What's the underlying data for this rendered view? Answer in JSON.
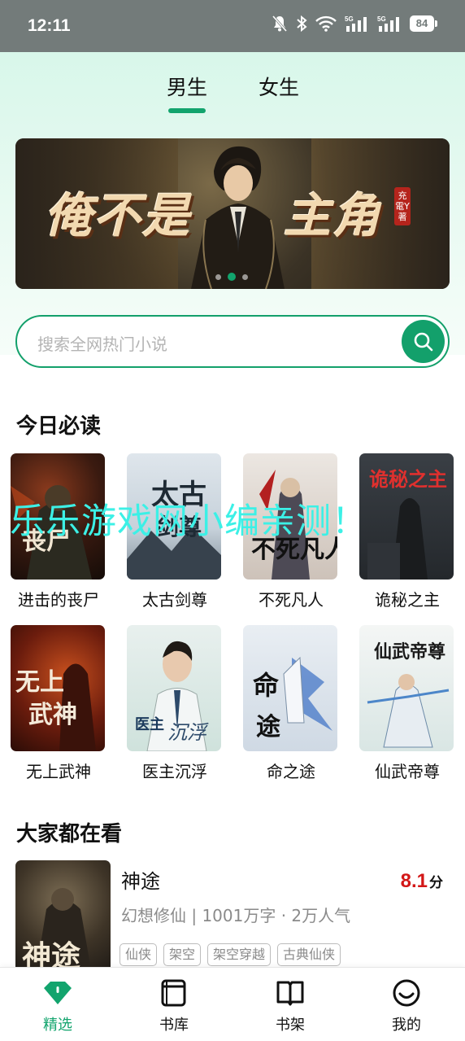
{
  "status_bar": {
    "time": "12:11",
    "battery": "84"
  },
  "gender_tabs": {
    "male": "男生",
    "female": "女生"
  },
  "banner": {
    "title_left": "俺不是",
    "title_right": "主角",
    "author": "充電Y著"
  },
  "search": {
    "placeholder": "搜索全网热门小说"
  },
  "today_section": {
    "title": "今日必读",
    "books": [
      {
        "name": "进击的丧尸"
      },
      {
        "name": "太古剑尊"
      },
      {
        "name": "不死凡人"
      },
      {
        "name": "诡秘之主"
      },
      {
        "name": "无上武神"
      },
      {
        "name": "医主沉浮"
      },
      {
        "name": "命之途"
      },
      {
        "name": "仙武帝尊"
      }
    ]
  },
  "watermark": "乐乐游戏网小编亲测！",
  "popular_section": {
    "title": "大家都在看",
    "item": {
      "title": "神途",
      "score": "8.1",
      "score_unit": "分",
      "meta": "幻想修仙 | 1001万字 · 2万人气",
      "tags": [
        "仙侠",
        "架空",
        "架空穿越",
        "古典仙侠"
      ],
      "cover_text": "神途"
    }
  },
  "bottom_nav": [
    {
      "label": "精选",
      "icon": "diamond-icon",
      "active": true
    },
    {
      "label": "书库",
      "icon": "library-icon",
      "active": false
    },
    {
      "label": "书架",
      "icon": "open-book-icon",
      "active": false
    },
    {
      "label": "我的",
      "icon": "smiley-icon",
      "active": false
    }
  ],
  "colors": {
    "accent": "#12a46d",
    "score": "#d31717"
  }
}
